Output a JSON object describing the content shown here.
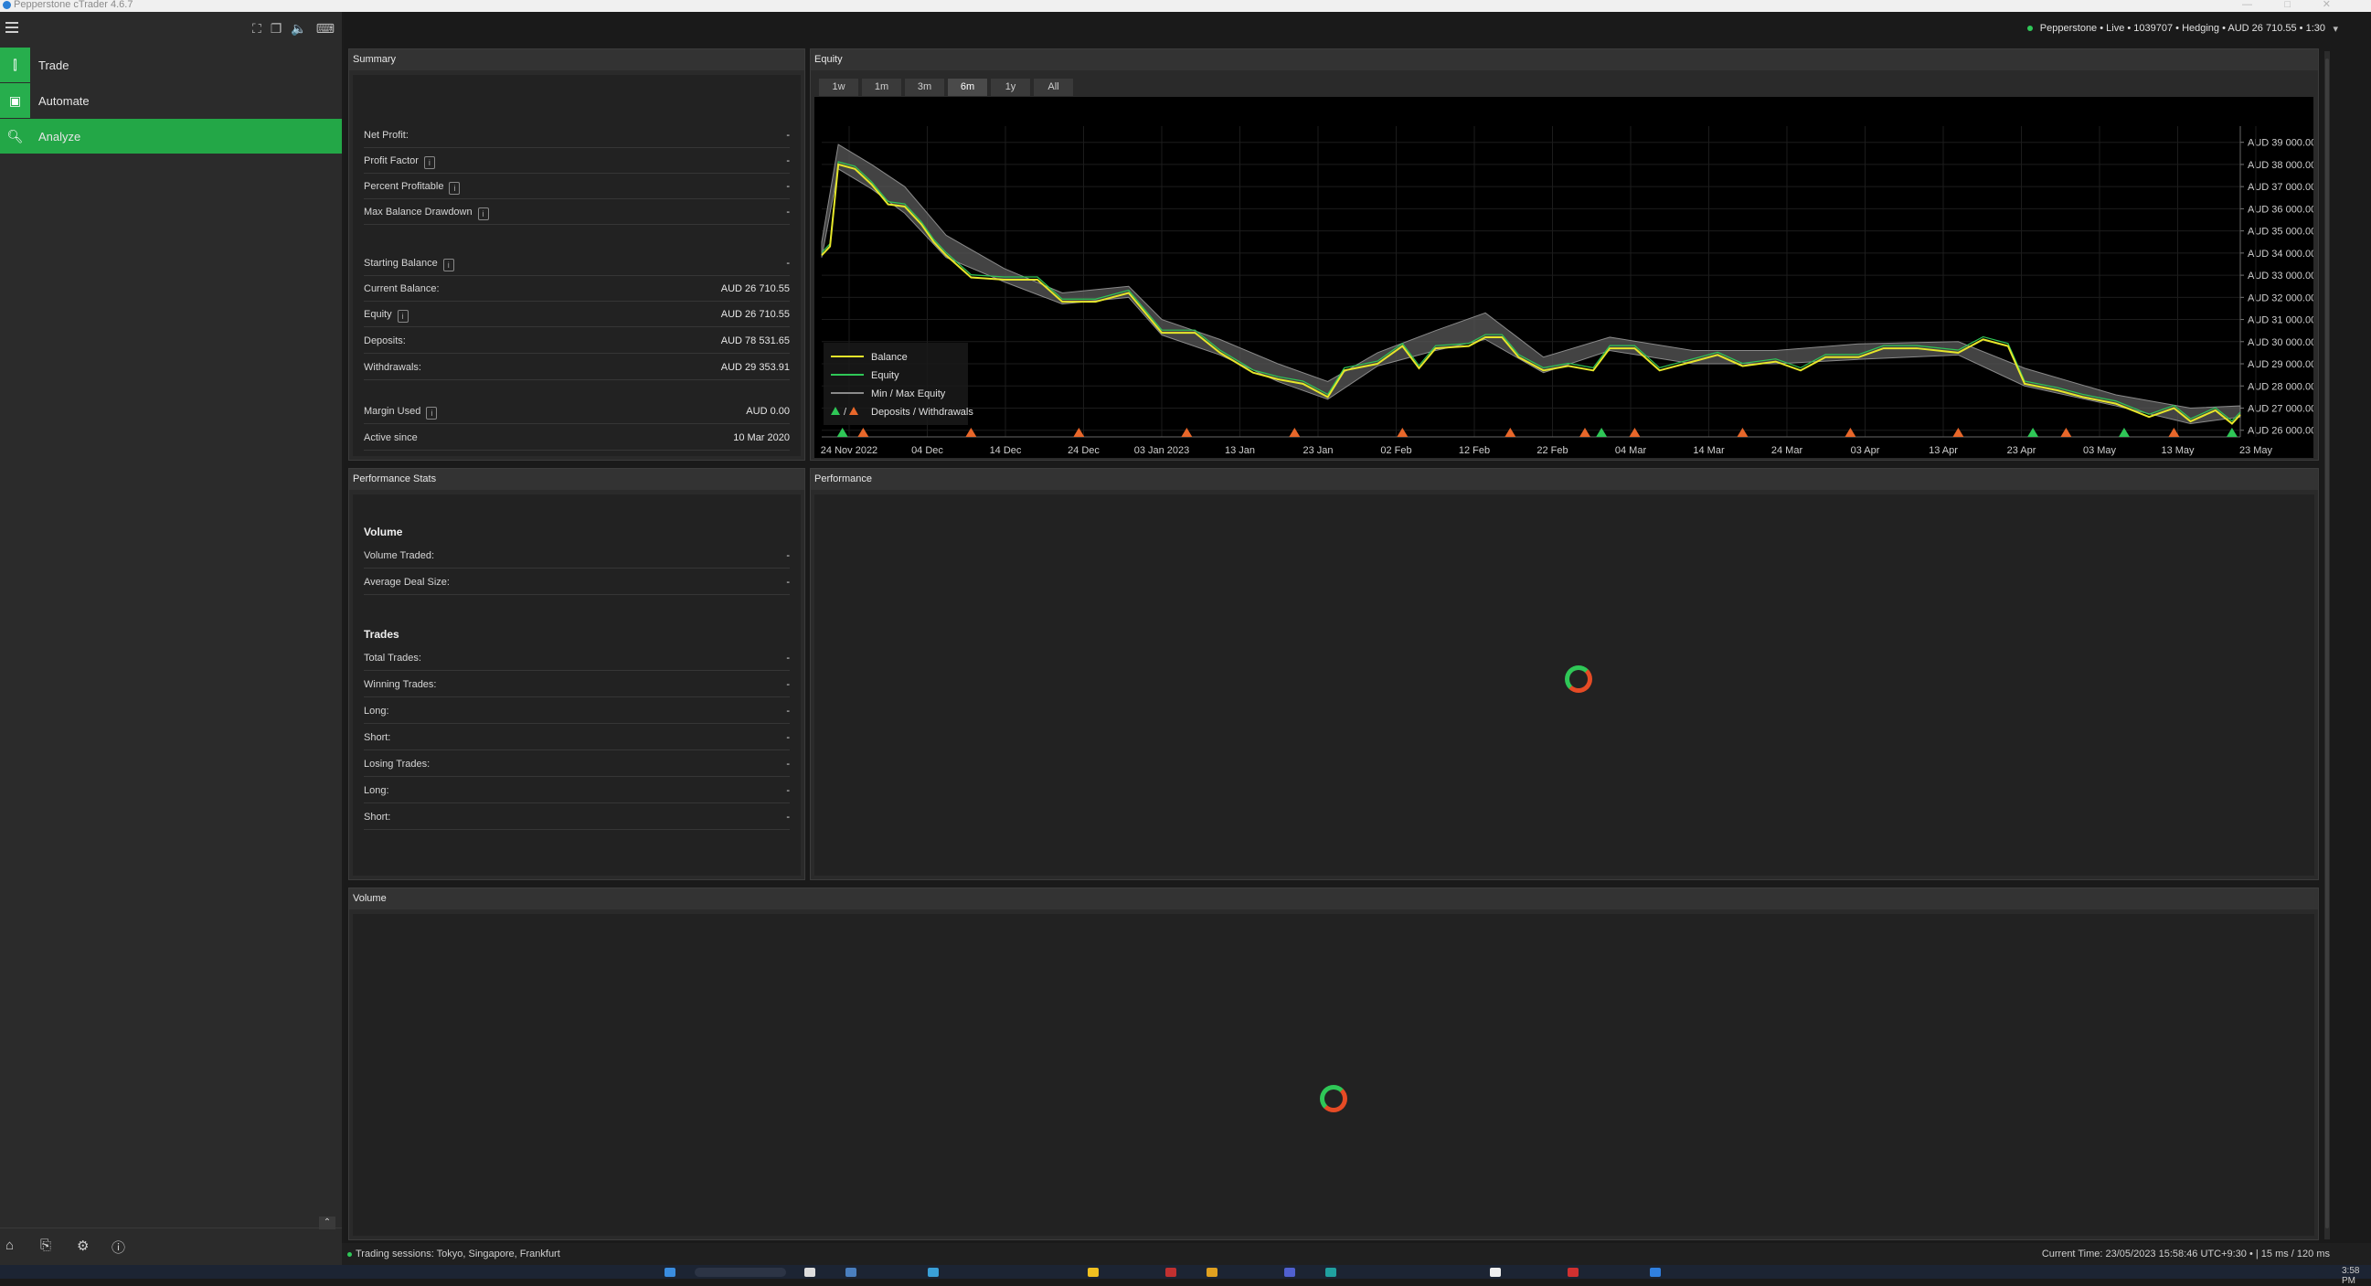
{
  "window": {
    "title": "Pepperstone cTrader 4.6.7"
  },
  "sidebar": {
    "items": [
      {
        "label": "Trade",
        "icon": "candles-icon",
        "active": false
      },
      {
        "label": "Automate",
        "icon": "robot-icon",
        "active": false
      },
      {
        "label": "Analyze",
        "icon": "analyze-icon",
        "active": true
      }
    ]
  },
  "account": {
    "text": "Pepperstone • Live • 1039707 • Hedging • AUD 26 710.55 • 1:30"
  },
  "summary": {
    "title": "Summary",
    "rows": [
      {
        "label": "Net Profit:",
        "value": "-"
      },
      {
        "label": "Profit Factor",
        "value": "-",
        "info": true
      },
      {
        "label": "Percent Profitable",
        "value": "-",
        "info": true
      },
      {
        "label": "Max Balance Drawdown",
        "value": "-",
        "info": true
      },
      {
        "label": "Starting Balance",
        "value": "-",
        "info": true
      },
      {
        "label": "Current Balance:",
        "value": "AUD 26 710.55"
      },
      {
        "label": "Equity",
        "value": "AUD 26 710.55",
        "info": true
      },
      {
        "label": "Deposits:",
        "value": "AUD 78 531.65"
      },
      {
        "label": "Withdrawals:",
        "value": "AUD 29 353.91"
      },
      {
        "label": "Margin Used",
        "value": "AUD 0.00",
        "info": true
      },
      {
        "label": "Active since",
        "value": "10 Mar 2020"
      }
    ]
  },
  "equity": {
    "title": "Equity",
    "ranges": [
      "1w",
      "1m",
      "3m",
      "6m",
      "1y",
      "All"
    ],
    "selected_range": "6m",
    "legend": [
      "Balance",
      "Equity",
      "Min / Max Equity",
      "Deposits / Withdrawals"
    ],
    "legend_slash": "/"
  },
  "chart_data": {
    "type": "line",
    "title": "Equity",
    "x_ticks": [
      "24 Nov 2022",
      "04 Dec",
      "14 Dec",
      "24 Dec",
      "03 Jan 2023",
      "13 Jan",
      "23 Jan",
      "02 Feb",
      "12 Feb",
      "22 Feb",
      "04 Mar",
      "14 Mar",
      "24 Mar",
      "03 Apr",
      "13 Apr",
      "23 Apr",
      "03 May",
      "13 May",
      "23 May"
    ],
    "y_ticks": [
      "AUD 39 000.00",
      "AUD 38 000.00",
      "AUD 37 000.00",
      "AUD 36 000.00",
      "AUD 35 000.00",
      "AUD 34 000.00",
      "AUD 33 000.00",
      "AUD 32 000.00",
      "AUD 31 000.00",
      "AUD 30 000.00",
      "AUD 29 000.00",
      "AUD 28 000.00",
      "AUD 27 000.00",
      "AUD 26 000.00"
    ],
    "ylim": [
      25700,
      39400
    ],
    "xlim": [
      0,
      182
    ],
    "grid": true,
    "legend_position": "bottom-left",
    "series": [
      {
        "name": "Balance",
        "color": "#e6e62a",
        "points": [
          [
            0,
            33900
          ],
          [
            2,
            34300
          ],
          [
            4,
            38000
          ],
          [
            8,
            37800
          ],
          [
            12,
            37100
          ],
          [
            16,
            36200
          ],
          [
            20,
            36100
          ],
          [
            24,
            35300
          ],
          [
            27,
            34500
          ],
          [
            30,
            33900
          ],
          [
            36,
            32900
          ],
          [
            44,
            32800
          ],
          [
            52,
            32800
          ],
          [
            58,
            31800
          ],
          [
            66,
            31800
          ],
          [
            74,
            32200
          ],
          [
            82,
            30400
          ],
          [
            90,
            30400
          ],
          [
            96,
            29500
          ],
          [
            104,
            28600
          ],
          [
            110,
            28300
          ],
          [
            116,
            28100
          ],
          [
            122,
            27500
          ],
          [
            126,
            28700
          ],
          [
            134,
            29000
          ],
          [
            140,
            29800
          ],
          [
            144,
            28800
          ],
          [
            148,
            29700
          ],
          [
            156,
            29800
          ],
          [
            160,
            30200
          ],
          [
            164,
            30200
          ],
          [
            168,
            29300
          ],
          [
            174,
            28700
          ],
          [
            180,
            28900
          ],
          [
            186,
            28700
          ],
          [
            190,
            29700
          ],
          [
            196,
            29700
          ],
          [
            202,
            28700
          ],
          [
            210,
            29100
          ],
          [
            216,
            29400
          ],
          [
            222,
            28900
          ],
          [
            230,
            29100
          ],
          [
            236,
            28700
          ],
          [
            242,
            29300
          ],
          [
            250,
            29300
          ],
          [
            256,
            29700
          ],
          [
            264,
            29700
          ],
          [
            274,
            29500
          ],
          [
            280,
            30100
          ],
          [
            286,
            29800
          ],
          [
            290,
            28100
          ],
          [
            298,
            27800
          ],
          [
            304,
            27500
          ],
          [
            312,
            27200
          ],
          [
            320,
            26600
          ],
          [
            326,
            27000
          ],
          [
            330,
            26400
          ],
          [
            336,
            26900
          ],
          [
            340,
            26300
          ],
          [
            342,
            26700
          ]
        ],
        "x_units_note": ""
      },
      {
        "name": "Min / Max Equity",
        "color": "#7a7a7a",
        "min": [
          [
            0,
            33800
          ],
          [
            4,
            37800
          ],
          [
            12,
            36900
          ],
          [
            20,
            35800
          ],
          [
            30,
            33800
          ],
          [
            44,
            32700
          ],
          [
            58,
            31700
          ],
          [
            74,
            32000
          ],
          [
            82,
            30300
          ],
          [
            96,
            29400
          ],
          [
            110,
            28200
          ],
          [
            122,
            27400
          ],
          [
            134,
            28900
          ],
          [
            148,
            29600
          ],
          [
            160,
            30100
          ],
          [
            174,
            28600
          ],
          [
            190,
            29600
          ],
          [
            210,
            29000
          ],
          [
            230,
            29000
          ],
          [
            250,
            29200
          ],
          [
            274,
            29400
          ],
          [
            290,
            28000
          ],
          [
            312,
            27100
          ],
          [
            330,
            26300
          ],
          [
            342,
            26600
          ]
        ],
        "max": [
          [
            0,
            34500
          ],
          [
            4,
            38900
          ],
          [
            12,
            38000
          ],
          [
            20,
            37000
          ],
          [
            30,
            34800
          ],
          [
            44,
            33300
          ],
          [
            58,
            32200
          ],
          [
            74,
            32500
          ],
          [
            82,
            31000
          ],
          [
            96,
            30100
          ],
          [
            110,
            29000
          ],
          [
            122,
            28200
          ],
          [
            134,
            29500
          ],
          [
            148,
            30500
          ],
          [
            160,
            31300
          ],
          [
            174,
            29300
          ],
          [
            190,
            30200
          ],
          [
            210,
            29600
          ],
          [
            230,
            29600
          ],
          [
            250,
            29900
          ],
          [
            274,
            30000
          ],
          [
            290,
            28800
          ],
          [
            312,
            27600
          ],
          [
            330,
            27000
          ],
          [
            342,
            27100
          ]
        ]
      }
    ],
    "deposits_withdrawals": [
      {
        "kind": "deposit",
        "x": 5,
        "color": "#2fc757"
      },
      {
        "kind": "withdrawal",
        "x": 10,
        "color": "#e8672a"
      },
      {
        "kind": "withdrawal",
        "x": 36,
        "color": "#e8672a"
      },
      {
        "kind": "withdrawal",
        "x": 62,
        "color": "#e8672a"
      },
      {
        "kind": "withdrawal",
        "x": 88,
        "color": "#e8672a"
      },
      {
        "kind": "withdrawal",
        "x": 114,
        "color": "#e8672a"
      },
      {
        "kind": "withdrawal",
        "x": 140,
        "color": "#e8672a"
      },
      {
        "kind": "withdrawal",
        "x": 166,
        "color": "#e8672a"
      },
      {
        "kind": "withdrawal",
        "x": 184,
        "color": "#e8672a"
      },
      {
        "kind": "deposit",
        "x": 188,
        "color": "#2fc757"
      },
      {
        "kind": "withdrawal",
        "x": 196,
        "color": "#e8672a"
      },
      {
        "kind": "withdrawal",
        "x": 222,
        "color": "#e8672a"
      },
      {
        "kind": "withdrawal",
        "x": 248,
        "color": "#e8672a"
      },
      {
        "kind": "withdrawal",
        "x": 274,
        "color": "#e8672a"
      },
      {
        "kind": "deposit",
        "x": 292,
        "color": "#2fc757"
      },
      {
        "kind": "withdrawal",
        "x": 300,
        "color": "#e8672a"
      },
      {
        "kind": "deposit",
        "x": 314,
        "color": "#2fc757"
      },
      {
        "kind": "withdrawal",
        "x": 326,
        "color": "#e8672a"
      },
      {
        "kind": "deposit",
        "x": 340,
        "color": "#2fc757"
      }
    ]
  },
  "performance_stats": {
    "title": "Performance Stats",
    "volume_header": "Volume",
    "volume_rows": [
      {
        "label": "Volume Traded:",
        "value": "-"
      },
      {
        "label": "Average Deal Size:",
        "value": "-"
      }
    ],
    "trades_header": "Trades",
    "trades_rows": [
      {
        "label": "Total Trades:",
        "value": "-"
      },
      {
        "label": "Winning Trades:",
        "value": "-"
      },
      {
        "label": "Long:",
        "value": "-"
      },
      {
        "label": "Short:",
        "value": "-"
      },
      {
        "label": "Losing Trades:",
        "value": "-"
      },
      {
        "label": "Long:",
        "value": "-"
      },
      {
        "label": "Short:",
        "value": "-"
      }
    ]
  },
  "performance": {
    "title": "Performance"
  },
  "volume": {
    "title": "Volume"
  },
  "status": {
    "sessions": "Trading sessions: Tokyo, Singapore, Frankfurt",
    "right": "Current Time: 23/05/2023 15:58:46   UTC+9:30   •   | 15 ms / 120 ms"
  },
  "taskbar": {
    "clock": "3:58 PM"
  },
  "colors": {
    "accent": "#23a747",
    "balance": "#e6e62a",
    "equity": "#2fc757",
    "withdrawal": "#e8672a"
  }
}
